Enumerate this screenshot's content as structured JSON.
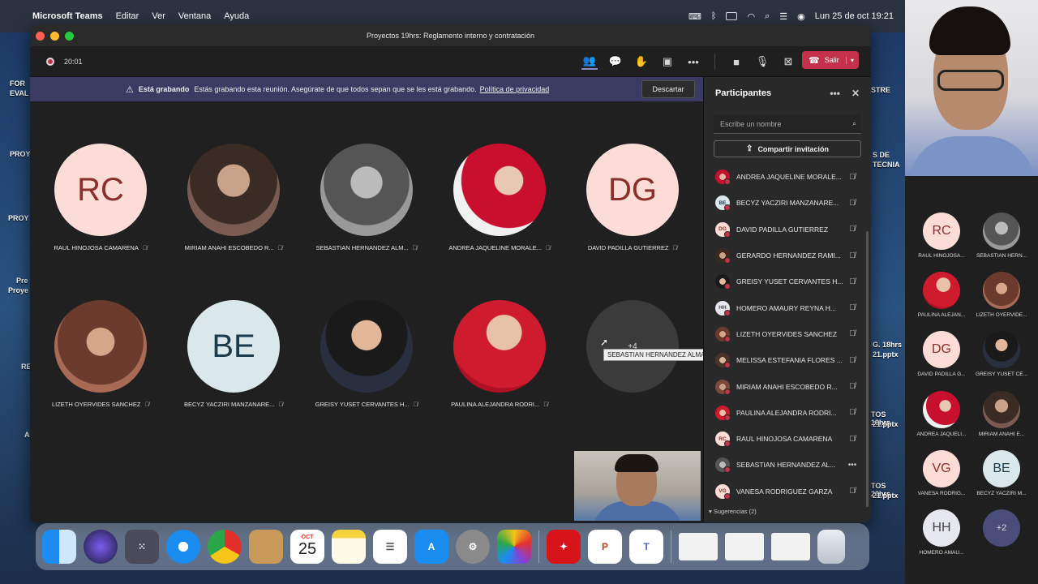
{
  "menubar": {
    "app_name": "Microsoft Teams",
    "menus": [
      "Editar",
      "Ver",
      "Ventana",
      "Ayuda"
    ],
    "datetime": "Lun 25 de oct  19:21"
  },
  "desktop": {
    "labels": [
      "FOR",
      "EVAL",
      "PROY",
      "PROY",
      "Pre",
      "Proye",
      "RE",
      "A",
      "STRE",
      "S DE",
      "TECNIA",
      "G. 18hrs",
      "21.pptx",
      "TOS 19hrs",
      "21.pptx",
      "TOS 20hrs",
      "21.pptx"
    ]
  },
  "window": {
    "title": "Proyectos 19hrs: Reglamento interno y contratación"
  },
  "toolbar": {
    "timer": "20:01",
    "leave_label": "Salir"
  },
  "banner": {
    "bold": "Está grabando",
    "text": "Estás grabando esta reunión. Asegúrate de que todos sepan que se les está grabando.",
    "link": "Política de privacidad",
    "dismiss": "Descartar"
  },
  "gallery": {
    "tiles": [
      {
        "name": "RAUL HINOJOSA CAMARENA",
        "initials": "RC"
      },
      {
        "name": "MIRIAM ANAHI ESCOBEDO R...",
        "initials": ""
      },
      {
        "name": "SEBASTIAN HERNANDEZ ALM...",
        "initials": ""
      },
      {
        "name": "ANDREA JAQUELINE MORALE...",
        "initials": ""
      },
      {
        "name": "DAVID PADILLA GUTIERREZ",
        "initials": "DG"
      },
      {
        "name": "LIZETH OYERVIDES SANCHEZ",
        "initials": ""
      },
      {
        "name": "BECYZ YACZIRI MANZANARE...",
        "initials": "BE"
      },
      {
        "name": "GREISY YUSET CERVANTES H...",
        "initials": ""
      },
      {
        "name": "PAULINA ALEJANDRA RODRI...",
        "initials": ""
      }
    ],
    "more_label": "+4",
    "tooltip": "SEBASTIAN HERNANDEZ ALMAGUER"
  },
  "panel": {
    "title": "Participantes",
    "search_placeholder": "Escribe un nombre",
    "share_label": "Compartir invitación",
    "participants": [
      {
        "name": "ANDREA JAQUELINE MORALE...",
        "initials": ""
      },
      {
        "name": "BECYZ YACZIRI MANZANARE...",
        "initials": "BE"
      },
      {
        "name": "DAVID PADILLA GUTIERREZ",
        "initials": "DG"
      },
      {
        "name": "GERARDO HERNANDEZ RAMI...",
        "initials": ""
      },
      {
        "name": "GREISY YUSET CERVANTES H...",
        "initials": ""
      },
      {
        "name": "HOMERO AMAURY REYNA H...",
        "initials": "HH"
      },
      {
        "name": "LIZETH OYERVIDES SANCHEZ",
        "initials": ""
      },
      {
        "name": "MELISSA ESTEFANIA FLORES ...",
        "initials": ""
      },
      {
        "name": "MIRIAM ANAHI ESCOBEDO R...",
        "initials": ""
      },
      {
        "name": "PAULINA ALEJANDRA RODRI...",
        "initials": ""
      },
      {
        "name": "RAUL HINOJOSA CAMARENA",
        "initials": "RC"
      },
      {
        "name": "SEBASTIAN HERNANDEZ AL...",
        "initials": ""
      },
      {
        "name": "VANESA RODRIGUEZ GARZA",
        "initials": "VG"
      }
    ],
    "suggestions": "Sugerencias (2)"
  },
  "dock": {
    "calendar_month": "OCT",
    "calendar_day": "25"
  },
  "rightstrip": {
    "tiles": [
      {
        "name": "RAUL HINOJOSA...",
        "initials": "RC"
      },
      {
        "name": "SEBASTIAN HERN...",
        "initials": ""
      },
      {
        "name": "PAULINA ALEJAN...",
        "initials": ""
      },
      {
        "name": "LIZETH OYERVIDE...",
        "initials": ""
      },
      {
        "name": "DAVID PADILLA G...",
        "initials": "DG"
      },
      {
        "name": "GREISY YUSET CE...",
        "initials": ""
      },
      {
        "name": "ANDREA JAQUELI...",
        "initials": ""
      },
      {
        "name": "MIRIAM ANAHI E...",
        "initials": ""
      },
      {
        "name": "VANESA RODRIG...",
        "initials": "VG"
      },
      {
        "name": "BECYZ YACZIRI M...",
        "initials": "BE"
      },
      {
        "name": "HOMERO AMAU...",
        "initials": "HH"
      }
    ],
    "more_label": "+2"
  },
  "colors": {
    "leave_red": "#c4314b",
    "banner_purple": "#3b3a63",
    "panel_bg": "#292929"
  }
}
